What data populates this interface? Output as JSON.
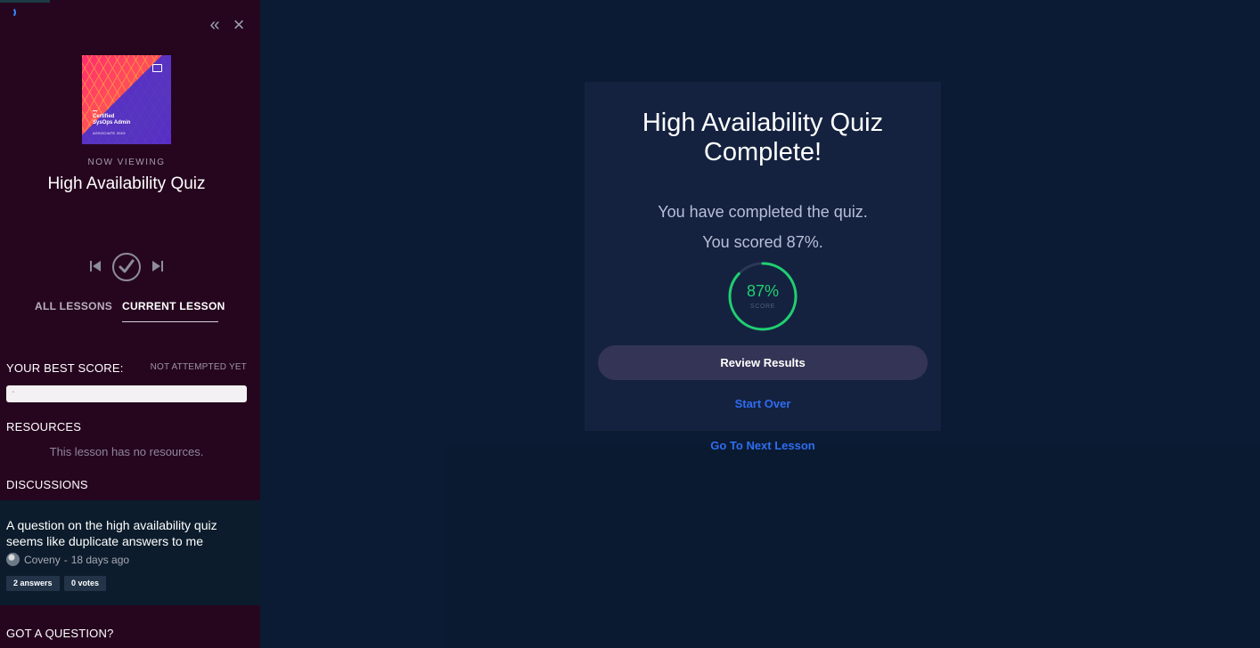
{
  "sidebar": {
    "course_thumbnail": {
      "line1": "Certified",
      "line2": "SysOps Admin",
      "line3": "ASSOCIATE 2019",
      "colors": {
        "primary": "#ff2d6f",
        "secondary": "#3b2bd6"
      }
    },
    "now_viewing_label": "NOW VIEWING",
    "lesson_title": "High Availability Quiz",
    "tabs": [
      {
        "label": "ALL LESSONS",
        "active": false
      },
      {
        "label": "CURRENT LESSON",
        "active": true
      }
    ],
    "best_score": {
      "label": "YOUR BEST SCORE:",
      "status": "NOT ATTEMPTED YET"
    },
    "resources": {
      "label": "RESOURCES",
      "empty_text": "This lesson has no resources."
    },
    "discussions": {
      "label": "DISCUSSIONS",
      "items": [
        {
          "title": "A question on the high availability quiz seems like duplicate answers to me",
          "author": "Coveny",
          "separator": "-",
          "time": "18 days ago",
          "answers": "2 answers",
          "votes": "0 votes"
        }
      ]
    },
    "got_question_label": "GOT A QUESTION?"
  },
  "main": {
    "card_title": "High Availability Quiz Complete!",
    "completed_text": "You have completed the quiz.",
    "scored_text": "You scored 87%.",
    "score": {
      "value": 87,
      "display": "87%",
      "label": "SCORE",
      "color": "#1fcf71"
    },
    "review_button_label": "Review Results",
    "start_over_label": "Start Over",
    "next_lesson_label": "Go To Next Lesson"
  },
  "colors": {
    "sidebar_bg": "#26061f",
    "main_bg": "#0b1b33",
    "card_bg": "#14223f",
    "link": "#2f6cf0"
  }
}
